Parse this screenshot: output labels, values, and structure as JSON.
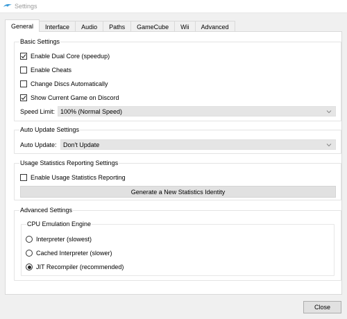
{
  "window": {
    "title": "Settings"
  },
  "tabs": [
    {
      "label": "General",
      "active": true
    },
    {
      "label": "Interface",
      "active": false
    },
    {
      "label": "Audio",
      "active": false
    },
    {
      "label": "Paths",
      "active": false
    },
    {
      "label": "GameCube",
      "active": false
    },
    {
      "label": "Wii",
      "active": false
    },
    {
      "label": "Advanced",
      "active": false
    }
  ],
  "basic": {
    "title": "Basic Settings",
    "options": [
      {
        "label": "Enable Dual Core (speedup)",
        "checked": true
      },
      {
        "label": "Enable Cheats",
        "checked": false
      },
      {
        "label": "Change Discs Automatically",
        "checked": false
      },
      {
        "label": "Show Current Game on Discord",
        "checked": true
      }
    ],
    "speed_limit_label": "Speed Limit:",
    "speed_limit_value": "100% (Normal Speed)"
  },
  "auto_update": {
    "title": "Auto Update Settings",
    "label": "Auto Update:",
    "value": "Don't Update"
  },
  "usage": {
    "title": "Usage Statistics Reporting Settings",
    "enable_label": "Enable Usage Statistics Reporting",
    "enable_checked": false,
    "generate_button": "Generate a New Statistics Identity"
  },
  "advanced": {
    "title": "Advanced Settings",
    "cpu_title": "CPU Emulation Engine",
    "engines": [
      {
        "label": "Interpreter (slowest)",
        "selected": false
      },
      {
        "label": "Cached Interpreter (slower)",
        "selected": false
      },
      {
        "label": "JIT Recompiler (recommended)",
        "selected": true
      }
    ]
  },
  "footer": {
    "close_label": "Close"
  },
  "colors": {
    "icon_accent": "#3a9bd9"
  }
}
